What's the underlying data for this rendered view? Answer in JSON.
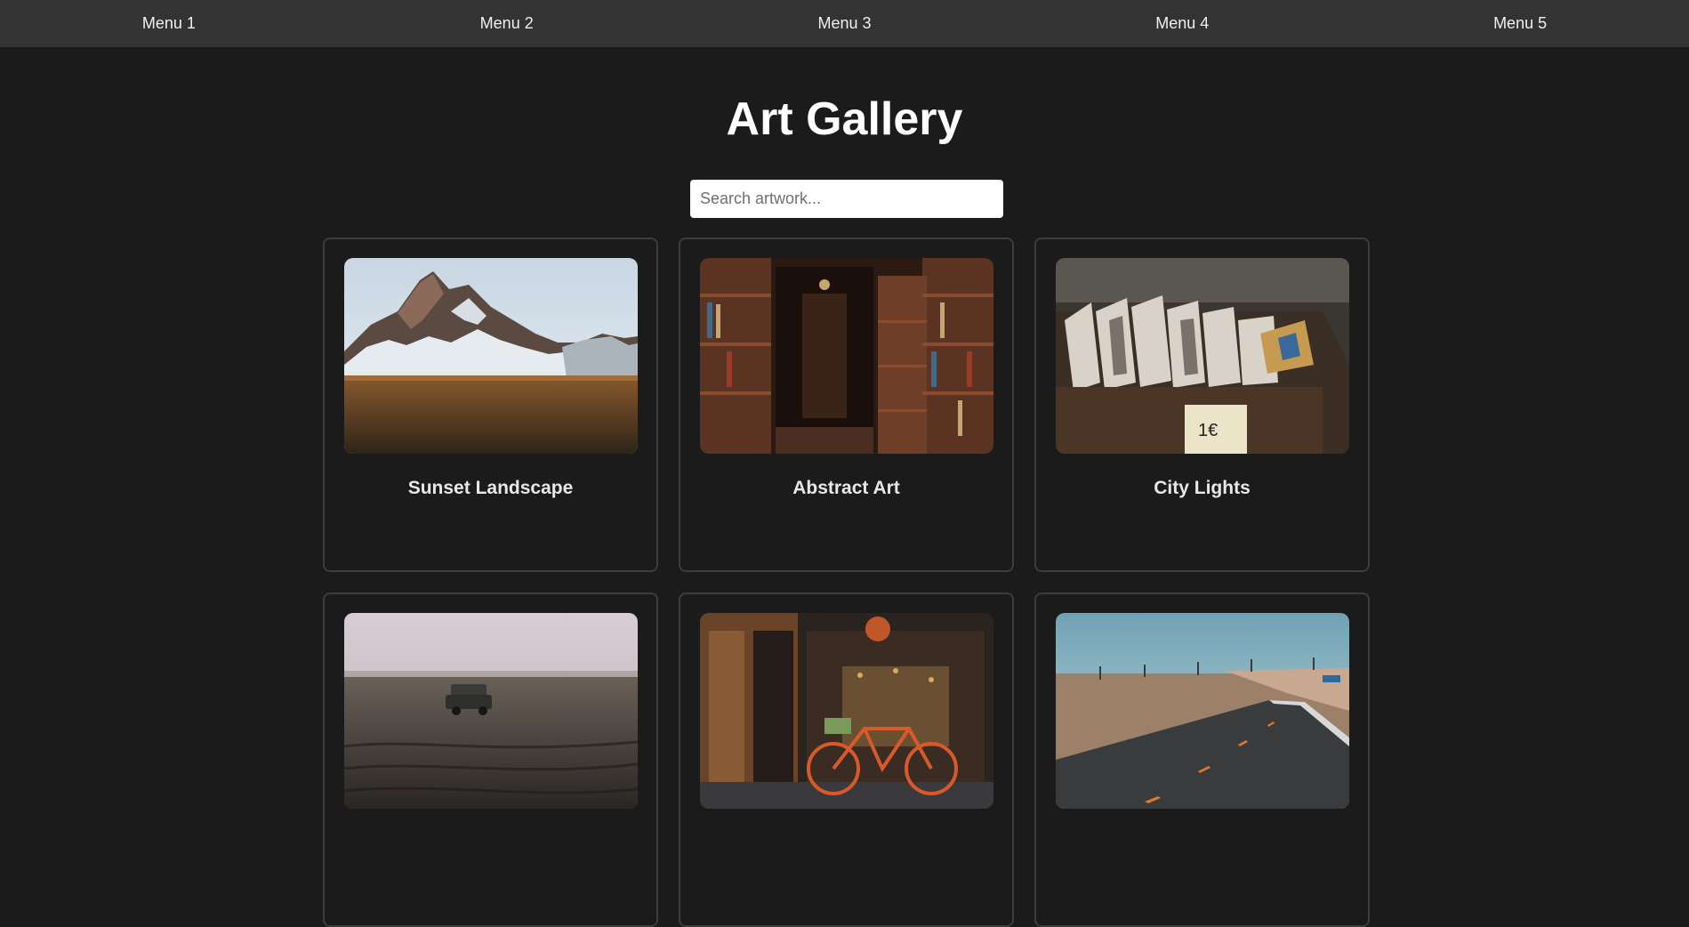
{
  "nav": {
    "items": [
      {
        "label": "Menu 1"
      },
      {
        "label": "Menu 2"
      },
      {
        "label": "Menu 3"
      },
      {
        "label": "Menu 4"
      },
      {
        "label": "Menu 5"
      }
    ]
  },
  "page": {
    "title": "Art Gallery"
  },
  "search": {
    "placeholder": "Search artwork...",
    "value": ""
  },
  "gallery": {
    "items": [
      {
        "title": "Sunset Landscape",
        "image": "mountain-snow-photo"
      },
      {
        "title": "Abstract Art",
        "image": "bookstore-shelves-photo"
      },
      {
        "title": "City Lights",
        "image": "record-crate-photo"
      },
      {
        "title": "",
        "image": "jeep-field-photo"
      },
      {
        "title": "",
        "image": "bicycle-storefront-photo"
      },
      {
        "title": "",
        "image": "desert-road-photo"
      }
    ]
  },
  "colors": {
    "background": "#1b1b1b",
    "nav_background": "#333333",
    "card_border": "#3d3d3d",
    "text": "#ffffff"
  }
}
